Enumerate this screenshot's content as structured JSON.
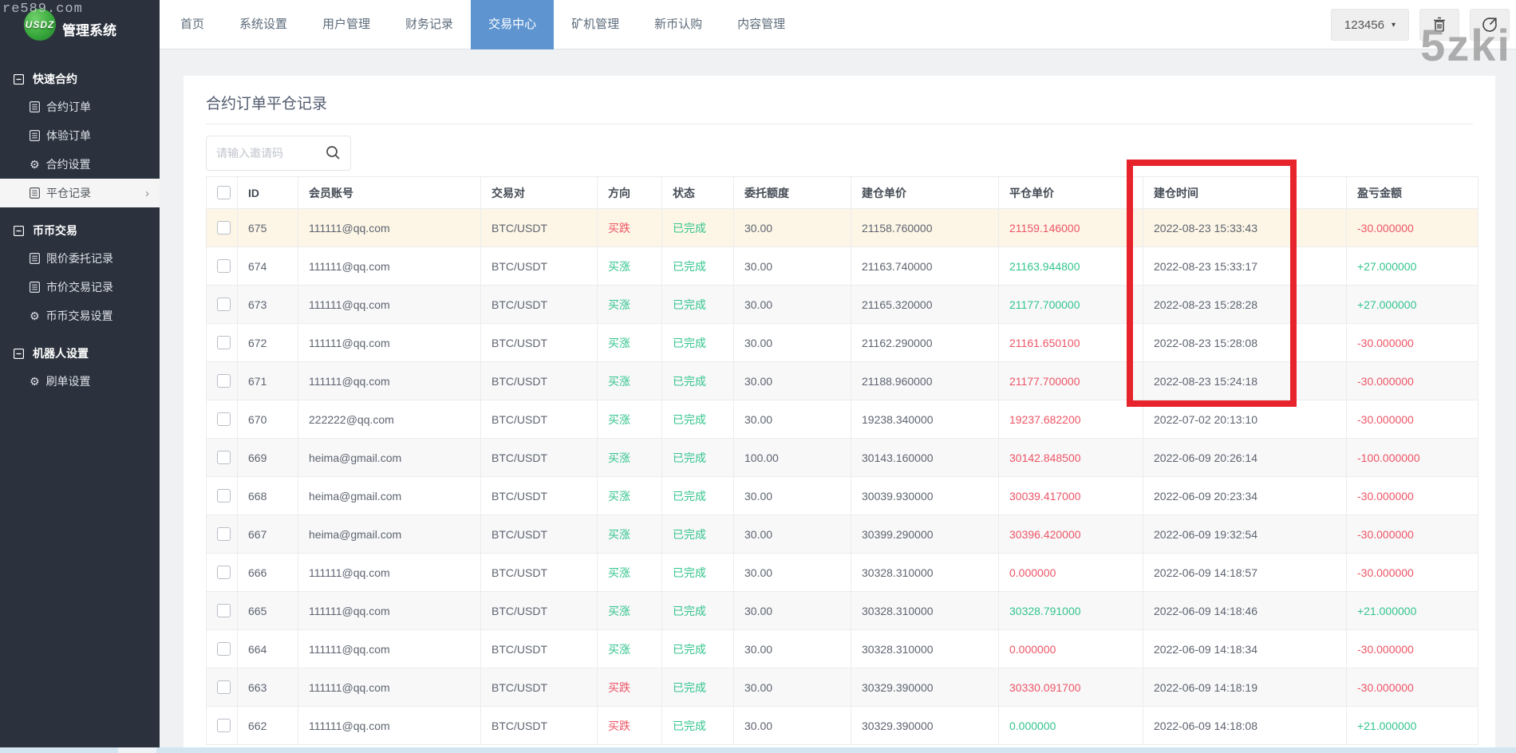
{
  "watermarks": {
    "top_left": "re589.com",
    "top_right": "5zki"
  },
  "topbar": {
    "logo": {
      "badge": "USDZ",
      "title": "管理系统"
    },
    "nav": [
      {
        "label": "首页",
        "active": false
      },
      {
        "label": "系统设置",
        "active": false
      },
      {
        "label": "用户管理",
        "active": false
      },
      {
        "label": "财务记录",
        "active": false
      },
      {
        "label": "交易中心",
        "active": true
      },
      {
        "label": "矿机管理",
        "active": false
      },
      {
        "label": "新币认购",
        "active": false
      },
      {
        "label": "内容管理",
        "active": false
      }
    ],
    "user_button": {
      "label": "123456",
      "caret": "▾"
    },
    "icon_buttons": [
      {
        "name": "trash"
      },
      {
        "name": "logout"
      }
    ]
  },
  "sidebar": {
    "sections": [
      {
        "title": "快速合约",
        "items": [
          {
            "label": "合约订单",
            "icon": "list",
            "active": false
          },
          {
            "label": "体验订单",
            "icon": "list",
            "active": false
          },
          {
            "label": "合约设置",
            "icon": "gear",
            "active": false
          },
          {
            "label": "平仓记录",
            "icon": "list",
            "active": true
          }
        ]
      },
      {
        "title": "币币交易",
        "items": [
          {
            "label": "限价委托记录",
            "icon": "list",
            "active": false
          },
          {
            "label": "市价交易记录",
            "icon": "list",
            "active": false
          },
          {
            "label": "币币交易设置",
            "icon": "gear",
            "active": false
          }
        ]
      },
      {
        "title": "机器人设置",
        "items": [
          {
            "label": "刷单设置",
            "icon": "gear",
            "active": false
          }
        ]
      }
    ],
    "gear_glyph": "⚙",
    "chevron_glyph": "›"
  },
  "main": {
    "title": "合约订单平仓记录",
    "search": {
      "placeholder": "请输入邀请码"
    },
    "table": {
      "headers": [
        "ID",
        "会员账号",
        "交易对",
        "方向",
        "状态",
        "委托额度",
        "建仓单价",
        "平仓单价",
        "建仓时间",
        "盈亏金额"
      ],
      "rows": [
        {
          "id": "675",
          "account": "111111@qq.com",
          "pair": "BTC/USDT",
          "direction": "买跌",
          "direction_color": "red",
          "status": "已完成",
          "amount": "30.00",
          "open_price": "21158.760000",
          "close_price": "21159.146000",
          "close_color": "red",
          "open_time": "2022-08-23 15:33:43",
          "profit": "-30.000000",
          "profit_color": "red",
          "bg": "cream"
        },
        {
          "id": "674",
          "account": "111111@qq.com",
          "pair": "BTC/USDT",
          "direction": "买涨",
          "direction_color": "green",
          "status": "已完成",
          "amount": "30.00",
          "open_price": "21163.740000",
          "close_price": "21163.944800",
          "close_color": "green",
          "open_time": "2022-08-23 15:33:17",
          "profit": "+27.000000",
          "profit_color": "green",
          "bg": ""
        },
        {
          "id": "673",
          "account": "111111@qq.com",
          "pair": "BTC/USDT",
          "direction": "买涨",
          "direction_color": "green",
          "status": "已完成",
          "amount": "30.00",
          "open_price": "21165.320000",
          "close_price": "21177.700000",
          "close_color": "green",
          "open_time": "2022-08-23 15:28:28",
          "profit": "+27.000000",
          "profit_color": "green",
          "bg": "alt"
        },
        {
          "id": "672",
          "account": "111111@qq.com",
          "pair": "BTC/USDT",
          "direction": "买涨",
          "direction_color": "green",
          "status": "已完成",
          "amount": "30.00",
          "open_price": "21162.290000",
          "close_price": "21161.650100",
          "close_color": "red",
          "open_time": "2022-08-23 15:28:08",
          "profit": "-30.000000",
          "profit_color": "red",
          "bg": ""
        },
        {
          "id": "671",
          "account": "111111@qq.com",
          "pair": "BTC/USDT",
          "direction": "买涨",
          "direction_color": "green",
          "status": "已完成",
          "amount": "30.00",
          "open_price": "21188.960000",
          "close_price": "21177.700000",
          "close_color": "red",
          "open_time": "2022-08-23 15:24:18",
          "profit": "-30.000000",
          "profit_color": "red",
          "bg": "alt"
        },
        {
          "id": "670",
          "account": "222222@qq.com",
          "pair": "BTC/USDT",
          "direction": "买涨",
          "direction_color": "green",
          "status": "已完成",
          "amount": "30.00",
          "open_price": "19238.340000",
          "close_price": "19237.682200",
          "close_color": "red",
          "open_time": "2022-07-02 20:13:10",
          "profit": "-30.000000",
          "profit_color": "red",
          "bg": ""
        },
        {
          "id": "669",
          "account": "heima@gmail.com",
          "pair": "BTC/USDT",
          "direction": "买涨",
          "direction_color": "green",
          "status": "已完成",
          "amount": "100.00",
          "open_price": "30143.160000",
          "close_price": "30142.848500",
          "close_color": "red",
          "open_time": "2022-06-09 20:26:14",
          "profit": "-100.000000",
          "profit_color": "red",
          "bg": "alt"
        },
        {
          "id": "668",
          "account": "heima@gmail.com",
          "pair": "BTC/USDT",
          "direction": "买涨",
          "direction_color": "green",
          "status": "已完成",
          "amount": "30.00",
          "open_price": "30039.930000",
          "close_price": "30039.417000",
          "close_color": "red",
          "open_time": "2022-06-09 20:23:34",
          "profit": "-30.000000",
          "profit_color": "red",
          "bg": ""
        },
        {
          "id": "667",
          "account": "heima@gmail.com",
          "pair": "BTC/USDT",
          "direction": "买涨",
          "direction_color": "green",
          "status": "已完成",
          "amount": "30.00",
          "open_price": "30399.290000",
          "close_price": "30396.420000",
          "close_color": "red",
          "open_time": "2022-06-09 19:32:54",
          "profit": "-30.000000",
          "profit_color": "red",
          "bg": "alt"
        },
        {
          "id": "666",
          "account": "111111@qq.com",
          "pair": "BTC/USDT",
          "direction": "买涨",
          "direction_color": "green",
          "status": "已完成",
          "amount": "30.00",
          "open_price": "30328.310000",
          "close_price": "0.000000",
          "close_color": "red",
          "open_time": "2022-06-09 14:18:57",
          "profit": "-30.000000",
          "profit_color": "red",
          "bg": ""
        },
        {
          "id": "665",
          "account": "111111@qq.com",
          "pair": "BTC/USDT",
          "direction": "买涨",
          "direction_color": "green",
          "status": "已完成",
          "amount": "30.00",
          "open_price": "30328.310000",
          "close_price": "30328.791000",
          "close_color": "green",
          "open_time": "2022-06-09 14:18:46",
          "profit": "+21.000000",
          "profit_color": "green",
          "bg": "alt"
        },
        {
          "id": "664",
          "account": "111111@qq.com",
          "pair": "BTC/USDT",
          "direction": "买涨",
          "direction_color": "green",
          "status": "已完成",
          "amount": "30.00",
          "open_price": "30328.310000",
          "close_price": "0.000000",
          "close_color": "red",
          "open_time": "2022-06-09 14:18:34",
          "profit": "-30.000000",
          "profit_color": "red",
          "bg": ""
        },
        {
          "id": "663",
          "account": "111111@qq.com",
          "pair": "BTC/USDT",
          "direction": "买跌",
          "direction_color": "red",
          "status": "已完成",
          "amount": "30.00",
          "open_price": "30329.390000",
          "close_price": "30330.091700",
          "close_color": "red",
          "open_time": "2022-06-09 14:18:19",
          "profit": "-30.000000",
          "profit_color": "red",
          "bg": "alt"
        },
        {
          "id": "662",
          "account": "111111@qq.com",
          "pair": "BTC/USDT",
          "direction": "买跌",
          "direction_color": "red",
          "status": "已完成",
          "amount": "30.00",
          "open_price": "30329.390000",
          "close_price": "0.000000",
          "close_color": "green",
          "open_time": "2022-06-09 14:18:08",
          "profit": "+21.000000",
          "profit_color": "green",
          "bg": ""
        }
      ]
    }
  },
  "annotation": {
    "shape": "rectangle",
    "color": "#e7232b",
    "target_column": "建仓时间"
  },
  "colors": {
    "green": "#33c48d",
    "red": "#ed5565",
    "active_tab_blue": "#5e95d0",
    "sidebar_bg": "#2b323d",
    "row_highlight": "#fdf6e6"
  }
}
